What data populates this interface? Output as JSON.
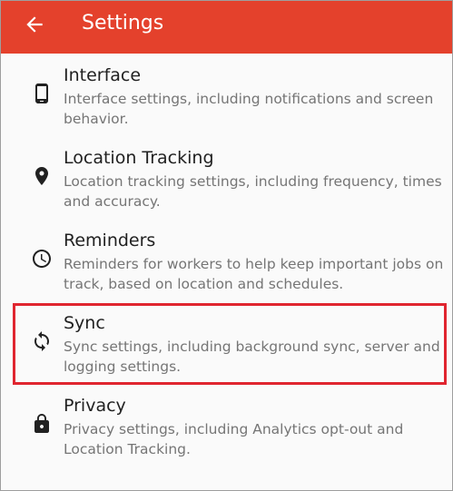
{
  "app_bar": {
    "title": "Settings",
    "background_color": "#e4412c",
    "back_icon": "arrow-left-icon"
  },
  "items": [
    {
      "id": "interface",
      "icon": "smartphone-icon",
      "title": "Interface",
      "description": "Interface settings, including notifications and screen behavior."
    },
    {
      "id": "location-tracking",
      "icon": "location-pin-icon",
      "title": "Location Tracking",
      "description": "Location tracking settings, including frequency, times and accuracy."
    },
    {
      "id": "reminders",
      "icon": "clock-icon",
      "title": "Reminders",
      "description": "Reminders for workers to help keep important jobs on track, based on location and schedules."
    },
    {
      "id": "sync",
      "icon": "sync-icon",
      "title": "Sync",
      "description": "Sync settings, including background sync, server and logging settings."
    },
    {
      "id": "privacy",
      "icon": "lock-icon",
      "title": "Privacy",
      "description": "Privacy settings, including Analytics opt-out and Location Tracking."
    }
  ],
  "highlight": {
    "target": "sync",
    "color": "#e0252f"
  }
}
